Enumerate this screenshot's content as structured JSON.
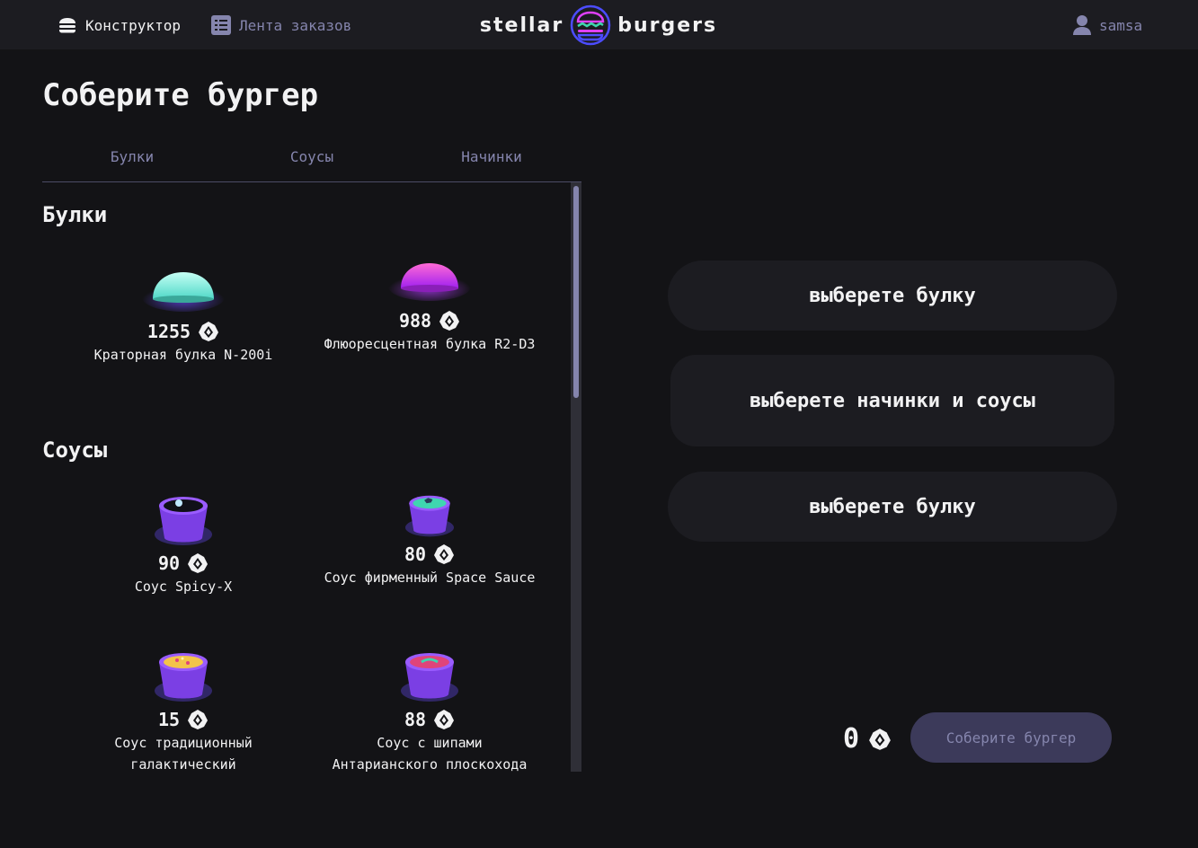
{
  "header": {
    "nav_constructor": "Конструктор",
    "nav_feed": "Лента заказов",
    "logo_left": "stellar",
    "logo_right": "burgers",
    "profile": "samsa"
  },
  "main": {
    "title": "Соберите бургер",
    "tabs": [
      "Булки",
      "Соусы",
      "Начинки"
    ],
    "sections": [
      {
        "title": "Булки",
        "items": [
          {
            "price": "1255",
            "name": "Краторная булка N-200i",
            "color": "#7ff0e0"
          },
          {
            "price": "988",
            "name": "Флюоресцентная булка R2-D3",
            "color": "#e040fb"
          }
        ]
      },
      {
        "title": "Соусы",
        "items": [
          {
            "price": "90",
            "name": "Соус Spicy-X",
            "color": "#101018"
          },
          {
            "price": "80",
            "name": "Соус фирменный Space Sauce",
            "color": "#3fd6b0"
          },
          {
            "price": "15",
            "name": "Соус традиционный галактический",
            "color": "#f3c44a"
          },
          {
            "price": "88",
            "name": "Соус с шипами Антарианского плоскохода",
            "color": "#e0447a"
          }
        ]
      }
    ]
  },
  "constructor": {
    "top_placeholder": "выберете булку",
    "middle_placeholder": "выберете начинки и соусы",
    "bottom_placeholder": "выберете булку",
    "total": "0",
    "order_button": "Соберите бургер"
  },
  "icons": {
    "currency": "currency-icon",
    "burger": "burger-icon",
    "list": "list-icon",
    "profile": "profile-icon"
  }
}
